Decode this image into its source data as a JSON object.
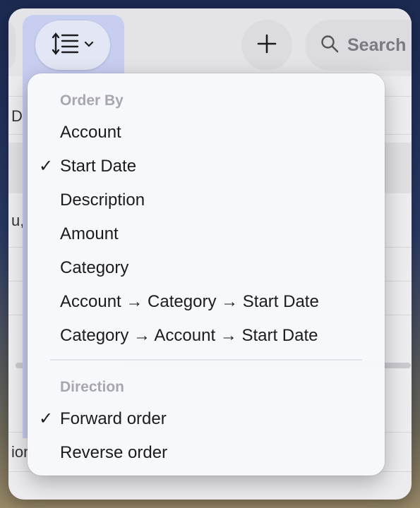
{
  "toolbar": {
    "sort_icon": "sort-lines-icon",
    "chevron_icon": "chevron-down-icon",
    "add_icon": "plus-icon",
    "search_icon": "magnifier-icon",
    "search_placeholder": "Search"
  },
  "background_fragments": {
    "col_header": "Da",
    "row_text_1": "u,",
    "row_text_2": "ion"
  },
  "menu": {
    "order_by_header": "Order By",
    "order_by_items": [
      {
        "label": "Account",
        "checked": false
      },
      {
        "label": "Start Date",
        "checked": true,
        "check": "✓"
      },
      {
        "label": "Description",
        "checked": false
      },
      {
        "label": "Amount",
        "checked": false
      },
      {
        "label": "Category",
        "checked": false
      },
      {
        "label": "Account → Category → Start Date",
        "checked": false
      },
      {
        "label": "Category → Account → Start Date",
        "checked": false
      }
    ],
    "direction_header": "Direction",
    "direction_items": [
      {
        "label": "Forward order",
        "checked": true,
        "check": "✓"
      },
      {
        "label": "Reverse order",
        "checked": false
      }
    ]
  },
  "colors": {
    "selection": "#c7cef0",
    "menu_bg": "#f7f8fb",
    "header_text": "#a7a7ad"
  }
}
